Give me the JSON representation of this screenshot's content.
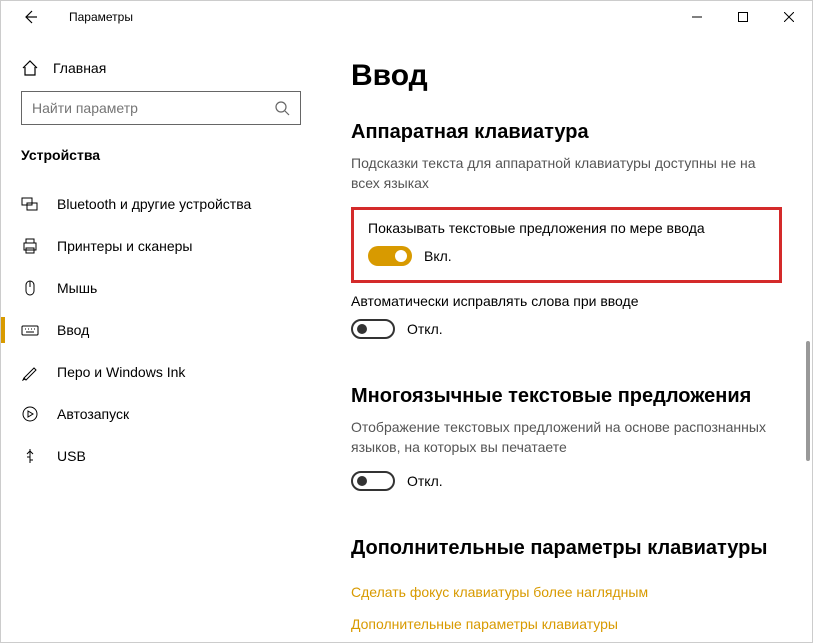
{
  "titlebar": {
    "title": "Параметры"
  },
  "sidebar": {
    "home": "Главная",
    "search_placeholder": "Найти параметр",
    "section": "Устройства",
    "items": [
      {
        "label": "Bluetooth и другие устройства"
      },
      {
        "label": "Принтеры и сканеры"
      },
      {
        "label": "Мышь"
      },
      {
        "label": "Ввод"
      },
      {
        "label": "Перо и Windows Ink"
      },
      {
        "label": "Автозапуск"
      },
      {
        "label": "USB"
      }
    ]
  },
  "main": {
    "title": "Ввод",
    "hw_heading": "Аппаратная клавиатура",
    "hw_desc": "Подсказки текста для аппаратной клавиатуры доступны не на всех языках",
    "suggestions_label": "Показывать текстовые предложения по мере ввода",
    "on_text": "Вкл.",
    "autocorrect_label": "Автоматически исправлять слова при вводе",
    "off_text": "Откл.",
    "multiling_heading": "Многоязычные текстовые предложения",
    "multiling_desc": "Отображение текстовых предложений на основе распознанных языков, на которых вы печатаете",
    "adv_heading": "Дополнительные параметры клавиатуры",
    "link1": "Сделать фокус клавиатуры более наглядным",
    "link2": "Дополнительные параметры клавиатуры"
  }
}
